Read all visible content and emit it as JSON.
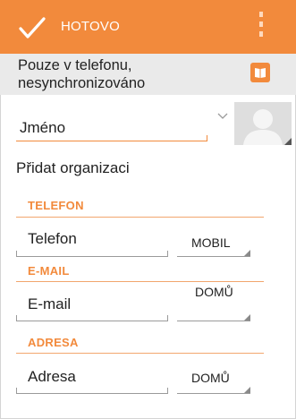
{
  "toolbar": {
    "done_label": "HOTOVO",
    "icons": {
      "confirm": "check-icon",
      "menu": "overflow-menu-icon"
    },
    "accent_color": "#f28a3c"
  },
  "account": {
    "line1": "Pouze v telefonu,",
    "line2": "nesynchronizováno",
    "icon": "book-icon"
  },
  "name": {
    "placeholder": "Jméno",
    "expand_icon": "chevron-down-icon",
    "photo_icon": "avatar-placeholder-icon"
  },
  "add_organization": "Přidat organizaci",
  "sections": {
    "phone": {
      "title": "TELEFON",
      "placeholder": "Telefon",
      "type": "MOBIL"
    },
    "email": {
      "title": "E-MAIL",
      "placeholder": "E-mail",
      "type": "DOMŮ"
    },
    "address": {
      "title": "ADRESA",
      "placeholder": "Adresa",
      "type": "DOMŮ"
    }
  }
}
